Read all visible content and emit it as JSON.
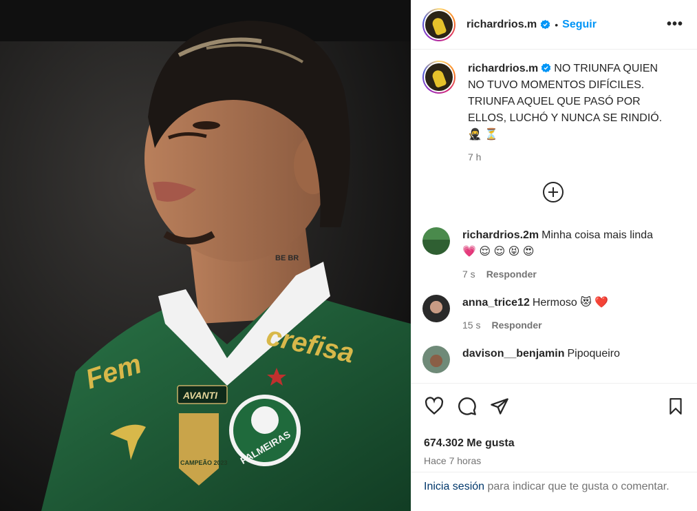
{
  "post": {
    "username": "richardrios.m",
    "dot": "•",
    "follow_label": "Seguir",
    "more_label": "•••",
    "caption_text": "NO TRIUNFA QUIEN NO TUVO MOMENTOS DIFÍCILES. TRIUNFA AQUEL QUE PASÓ POR ELLOS, LUCHÓ Y NUNCA SE RINDIÓ.",
    "caption_emojis": "🥷 ⏳",
    "caption_time": "7 h",
    "likes": "674.302 Me gusta",
    "posted_ago": "Hace 7 horas"
  },
  "photo": {
    "jersey_sponsor": "crefisa",
    "jersey_chest": "Fem",
    "jersey_badge": "PALMEIRAS",
    "jersey_avanti": "AVANTI",
    "trophy_text": "CAMPEÃO 2023",
    "neck_tattoo": "BE BR"
  },
  "comments": [
    {
      "user": "richardrios.2m",
      "text": "Minha coisa mais linda",
      "emojis": "💗 😌 😌 😝 😍",
      "time": "7 s",
      "reply": "Responder"
    },
    {
      "user": "anna_trice12",
      "text": "Hermoso",
      "emojis": "😻 ❤️",
      "time": "15 s",
      "reply": "Responder"
    },
    {
      "user": "davison__benjamin",
      "text": "Pipoqueiro",
      "emojis": "",
      "time": "",
      "reply": ""
    }
  ],
  "login": {
    "link": "Inicia sesión",
    "text": "para indicar que te gusta o comentar."
  },
  "colors": {
    "accent": "#0095f6",
    "jersey": "#1f5c37",
    "muted": "#737373"
  },
  "icons": [
    "verified-badge-icon",
    "more-options-icon",
    "load-more-comments-icon",
    "heart-icon",
    "comment-icon",
    "share-icon",
    "bookmark-icon"
  ]
}
